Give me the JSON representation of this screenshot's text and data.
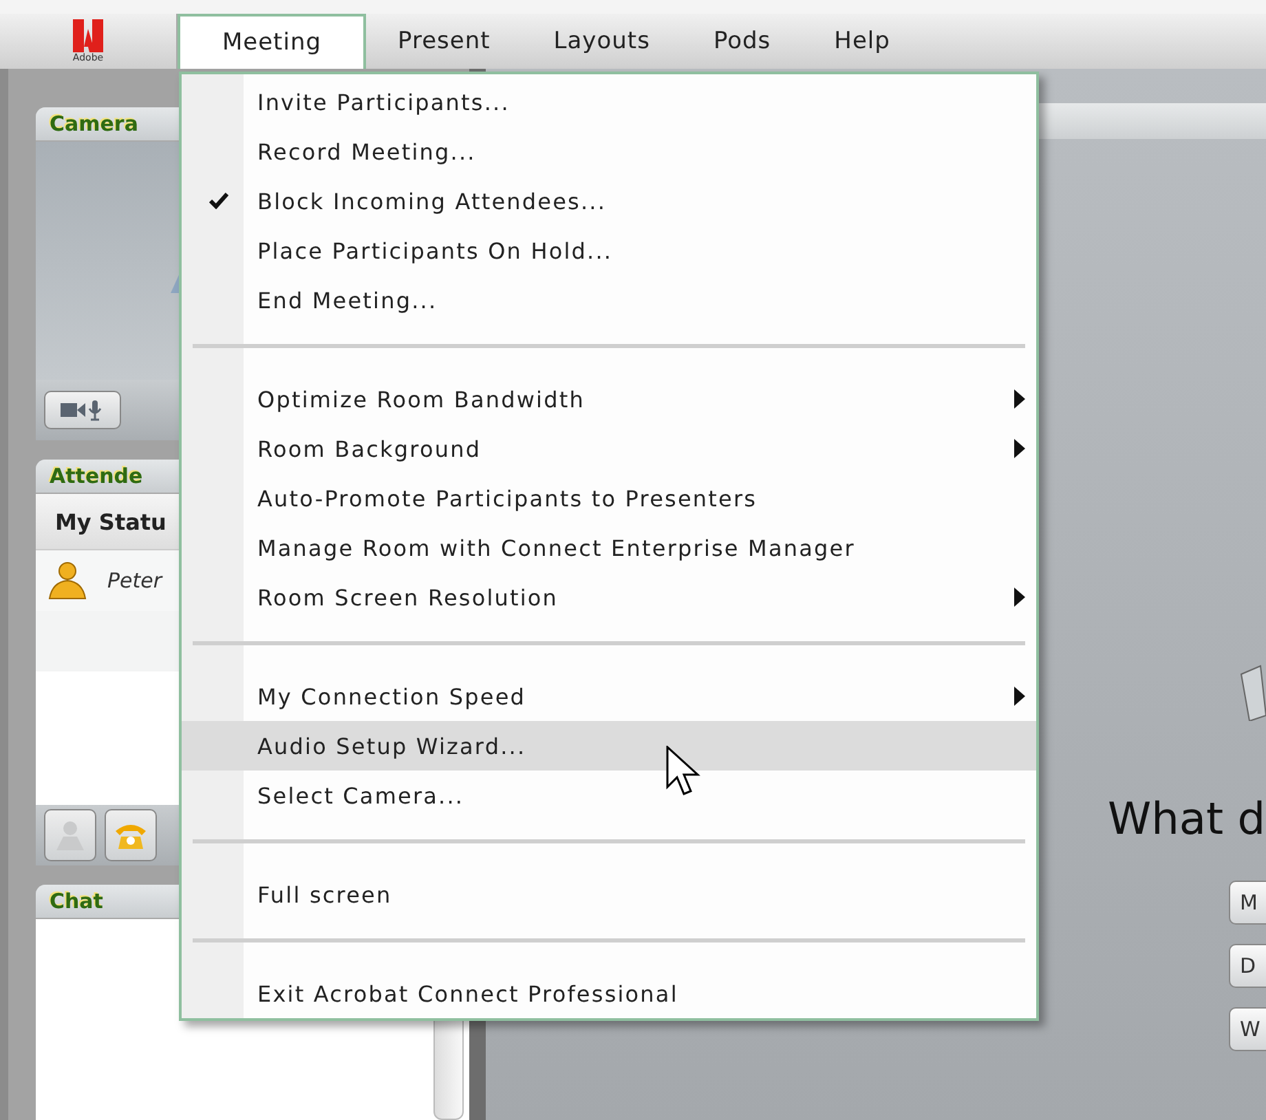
{
  "app_logo": {
    "label": "Adobe"
  },
  "menu_bar": [
    {
      "label": "Meeting",
      "selected": true
    },
    {
      "label": "Present",
      "selected": false
    },
    {
      "label": "Layouts",
      "selected": false
    },
    {
      "label": "Pods",
      "selected": false
    },
    {
      "label": "Help",
      "selected": false
    }
  ],
  "pods": {
    "camera": {
      "title": "Camera"
    },
    "attendees": {
      "title": "Attende",
      "column": "My Statu",
      "rows": [
        {
          "name": "Peter"
        }
      ]
    },
    "chat": {
      "title": "Chat"
    }
  },
  "stage": {
    "heading": "What d",
    "buttons": [
      "M",
      "D",
      "W"
    ]
  },
  "open_menu": {
    "sections": [
      [
        {
          "label": "Invite Participants...",
          "checked": false,
          "submenu": false,
          "selected": false
        },
        {
          "label": "Record Meeting...",
          "checked": false,
          "submenu": false,
          "selected": false
        },
        {
          "label": "Block Incoming Attendees...",
          "checked": true,
          "submenu": false,
          "selected": false
        },
        {
          "label": "Place Participants On Hold...",
          "checked": false,
          "submenu": false,
          "selected": false
        },
        {
          "label": "End Meeting...",
          "checked": false,
          "submenu": false,
          "selected": false
        }
      ],
      [
        {
          "label": "Optimize Room Bandwidth",
          "checked": false,
          "submenu": true,
          "selected": false
        },
        {
          "label": "Room Background",
          "checked": false,
          "submenu": true,
          "selected": false
        },
        {
          "label": "Auto-Promote Participants to Presenters",
          "checked": false,
          "submenu": false,
          "selected": false
        },
        {
          "label": "Manage Room with Connect Enterprise Manager",
          "checked": false,
          "submenu": false,
          "selected": false
        },
        {
          "label": "Room Screen Resolution",
          "checked": false,
          "submenu": true,
          "selected": false
        }
      ],
      [
        {
          "label": "My Connection Speed",
          "checked": false,
          "submenu": true,
          "selected": false
        },
        {
          "label": "Audio Setup Wizard...",
          "checked": false,
          "submenu": false,
          "selected": true
        },
        {
          "label": "Select Camera...",
          "checked": false,
          "submenu": false,
          "selected": false
        }
      ],
      [
        {
          "label": "Full screen",
          "checked": false,
          "submenu": false,
          "selected": false
        }
      ],
      [
        {
          "label": "Exit Acrobat Connect Professional",
          "checked": false,
          "submenu": false,
          "selected": false
        }
      ]
    ]
  }
}
